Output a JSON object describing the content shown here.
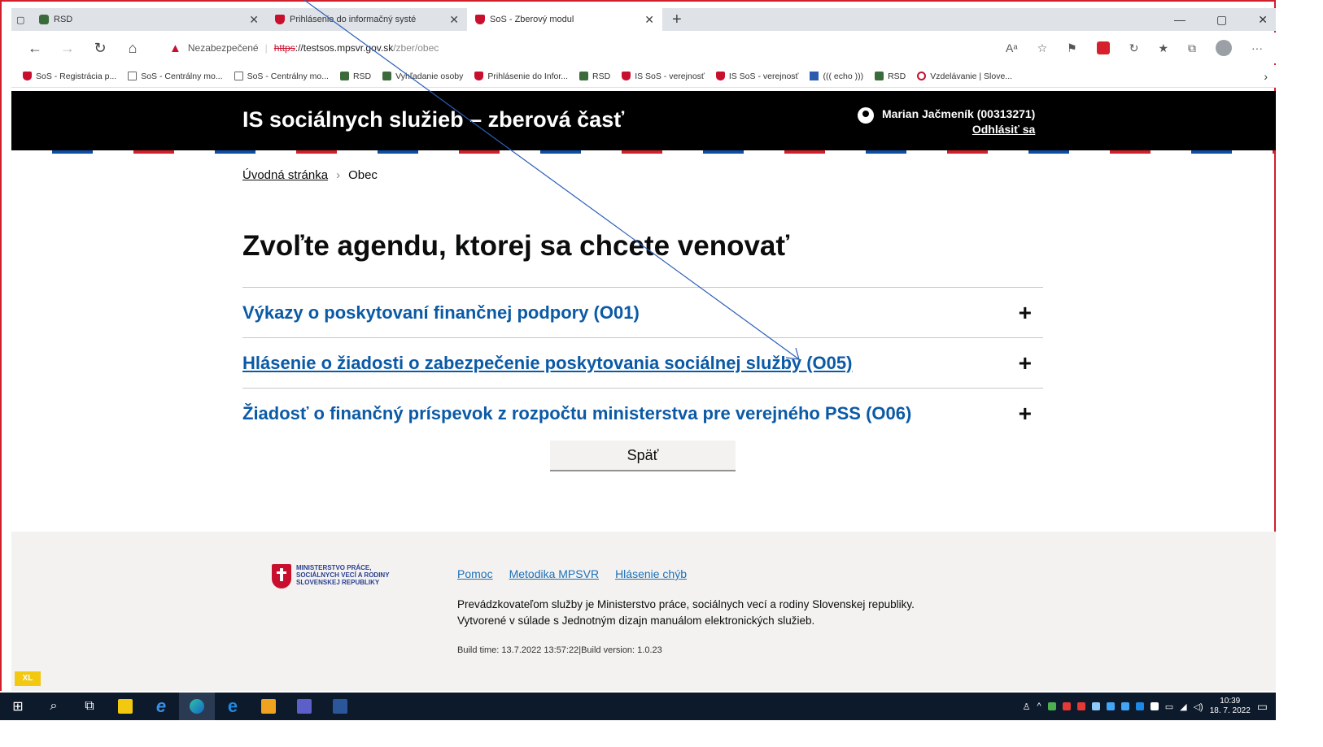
{
  "browser": {
    "tabs": [
      {
        "label": "RSD",
        "icon": "people-icon",
        "active": false
      },
      {
        "label": "Prihlásenie do informačný systé",
        "icon": "shield-icon",
        "active": false
      },
      {
        "label": "SoS - Zberový modul",
        "icon": "shield-icon",
        "active": true
      }
    ],
    "new_tab": "+",
    "window_controls": {
      "minimize": "—",
      "restore": "▢",
      "close": "✕"
    },
    "address": {
      "security_label": "Nezabezpečené",
      "protocol": "https",
      "host": "://testsos.mpsvr.gov.sk",
      "path": "/zber/obec"
    },
    "bookmarks": [
      {
        "label": "SoS - Registrácia p...",
        "icon": "shield-icon"
      },
      {
        "label": "SoS - Centrálny mo...",
        "icon": "page-icon"
      },
      {
        "label": "SoS - Centrálny mo...",
        "icon": "page-icon"
      },
      {
        "label": "RSD",
        "icon": "people-icon"
      },
      {
        "label": "Vyhľadanie osoby",
        "icon": "people-icon"
      },
      {
        "label": "Prihlásenie do Infor...",
        "icon": "shield-icon"
      },
      {
        "label": "RSD",
        "icon": "people-icon"
      },
      {
        "label": "IS SoS - verejnosť",
        "icon": "shield-icon"
      },
      {
        "label": "IS SoS - verejnosť",
        "icon": "shield-icon"
      },
      {
        "label": "((( echo )))",
        "icon": "blue-icon"
      },
      {
        "label": "RSD",
        "icon": "people-icon"
      },
      {
        "label": "Vzdelávanie | Slove...",
        "icon": "circle-icon"
      }
    ]
  },
  "header": {
    "title": "IS sociálnych služieb – zberová časť",
    "user_name": "Marian Jačmeník (00313271)",
    "logout": "Odhlásiť sa"
  },
  "breadcrumb": {
    "home": "Úvodná stránka",
    "current": "Obec"
  },
  "main": {
    "heading": "Zvoľte agendu, ktorej sa chcete venovať",
    "items": [
      {
        "label": "Výkazy o poskytovaní finančnej podpory (O01)"
      },
      {
        "label": "Hlásenie o žiadosti o zabezpečenie poskytovania sociálnej služby (O05)"
      },
      {
        "label": "Žiadosť o finančný príspevok z rozpočtu ministerstva pre verejného PSS (O06)"
      }
    ],
    "expand_symbol": "+",
    "back_button": "Späť"
  },
  "footer": {
    "logo_text": "MINISTERSTVO PRÁCE, SOCIÁLNYCH VECÍ A RODINY SLOVENSKEJ REPUBLIKY",
    "links": [
      "Pomoc",
      "Metodika MPSVR",
      "Hlásenie chýb"
    ],
    "line1": "Prevádzkovateľom služby je Ministerstvo práce, sociálnych vecí a rodiny Slovenskej republiky.",
    "line2": "Vytvorené v súlade s Jednotným dizajn manuálom elektronických služieb.",
    "build": "Build time: 13.7.2022 13:57:22|Build version: 1.0.23"
  },
  "badge": "XL",
  "taskbar": {
    "time": "10:39",
    "date": "18. 7. 2022"
  },
  "colors": {
    "link": "#0b5aa6",
    "header_bg": "#000000",
    "footer_bg": "#f3f2f1",
    "frame": "#d0202b"
  }
}
